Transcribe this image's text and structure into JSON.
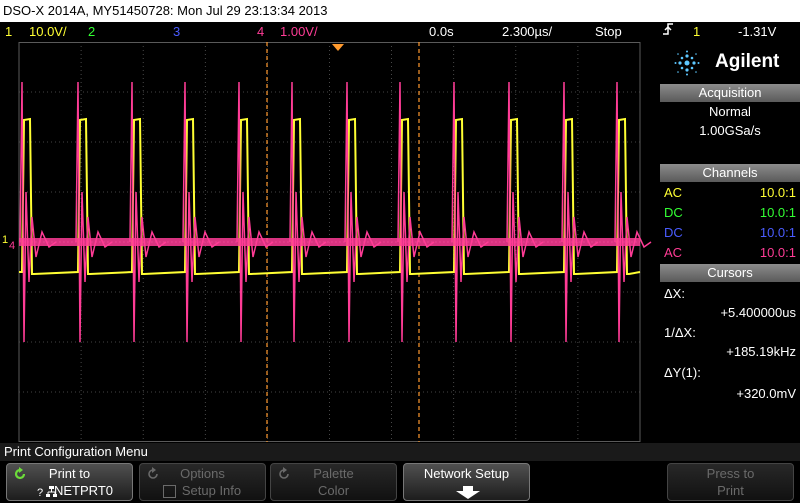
{
  "title_bar": "DSO-X 2014A, MY51450728: Mon Jul 29 23:13:34 2013",
  "status": {
    "ch1": {
      "num": "1",
      "scale": "10.0V/",
      "color": "#ffff33"
    },
    "ch2": {
      "num": "2",
      "color": "#33ff33"
    },
    "ch3": {
      "num": "3",
      "color": "#4a5cff"
    },
    "ch4": {
      "num": "4",
      "scale": "1.00V/",
      "color": "#ff3c96"
    },
    "delay": "0.0s",
    "timebase": "2.300µs/",
    "run_state": "Stop",
    "trigger_icon": "trigger-edge-icon",
    "trigger_source": "1",
    "trigger_level": "-1.31V"
  },
  "brand": {
    "logo": "agilent-spark-icon",
    "name": "Agilent"
  },
  "acquisition": {
    "header": "Acquisition",
    "mode": "Normal",
    "rate": "1.00GSa/s"
  },
  "channels": {
    "header": "Channels",
    "rows": [
      {
        "coupling": "AC",
        "probe": "10.0:1",
        "color": "#ffff33"
      },
      {
        "coupling": "DC",
        "probe": "10.0:1",
        "color": "#33ff33"
      },
      {
        "coupling": "DC",
        "probe": "10.0:1",
        "color": "#4a5cff"
      },
      {
        "coupling": "AC",
        "probe": "10.0:1",
        "color": "#ff3c96"
      }
    ]
  },
  "cursors": {
    "header": "Cursors",
    "dx_label": "ΔX:",
    "dx_value": "+5.400000us",
    "inv_label": "1/ΔX:",
    "inv_value": "+185.19kHz",
    "dy_label": "ΔY(1):",
    "dy_value": "+320.0mV"
  },
  "menu": {
    "title": "Print Configuration Menu",
    "softkeys": [
      {
        "line1": "Print to",
        "line2": "NETPRT0",
        "icon": "refresh-icon",
        "icon2": "network-icon",
        "enabled": true
      },
      {
        "line1": "Options",
        "line2": "Setup Info",
        "icon": "refresh-icon",
        "enabled": false
      },
      {
        "line1": "Palette",
        "line2": "Color",
        "icon": "refresh-icon",
        "enabled": false
      },
      {
        "line1": "Network Setup",
        "icon": "down-arrow-icon",
        "enabled": true
      },
      {
        "line1": "Press to",
        "line2": "Print",
        "enabled": false
      }
    ]
  },
  "markers": {
    "ch1_ground": "1",
    "ch4_ground": "4"
  },
  "colors": {
    "grid": "#5a5a5a",
    "cursor": "#ff9a2e",
    "trigger_marker": "#ff9a2e"
  }
}
